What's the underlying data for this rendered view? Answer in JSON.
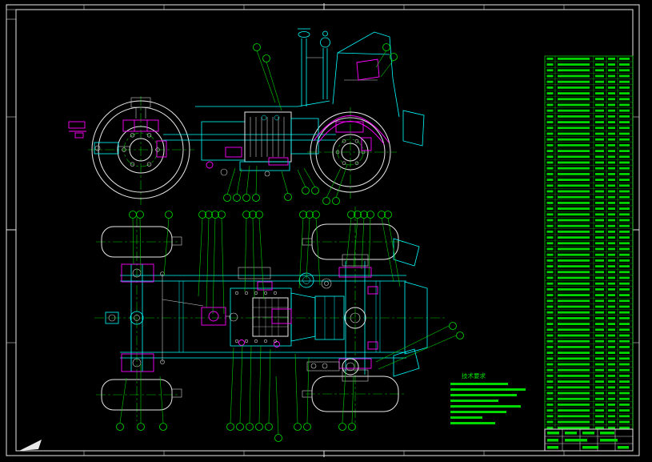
{
  "sheet": {
    "background": "#000000",
    "frame_color": "#e9e9e9"
  },
  "drawing": {
    "views": [
      {
        "id": "side-view"
      },
      {
        "id": "plan-view"
      }
    ],
    "tech_requirements_label": "技术要求",
    "tech_requirements_line_count": 8,
    "callout_balloon_count": 47
  },
  "palette": {
    "cyan": "#00ffff",
    "magenta": "#ff00ff",
    "green": "#00e000",
    "white": "#e9e9e9"
  },
  "parts_table": {
    "visible_rows": 64,
    "visible_columns": 5,
    "text_legible": false
  },
  "title_block": {
    "visible_rows": 3,
    "text_legible": false
  }
}
